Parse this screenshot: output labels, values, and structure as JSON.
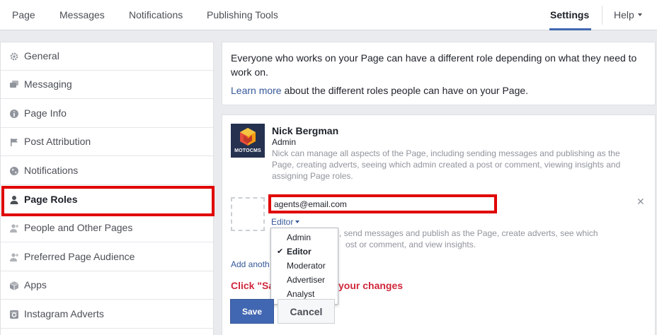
{
  "nav": {
    "items": [
      "Page",
      "Messages",
      "Notifications",
      "Publishing Tools"
    ],
    "settings": "Settings",
    "help": "Help"
  },
  "sidebar": {
    "items": [
      {
        "label": "General",
        "icon": "gear-icon"
      },
      {
        "label": "Messaging",
        "icon": "chat-icon"
      },
      {
        "label": "Page Info",
        "icon": "info-icon"
      },
      {
        "label": "Post Attribution",
        "icon": "flag-icon"
      },
      {
        "label": "Notifications",
        "icon": "globe-icon"
      },
      {
        "label": "Page Roles",
        "icon": "person-icon",
        "active": true
      },
      {
        "label": "People and Other Pages",
        "icon": "people-icon"
      },
      {
        "label": "Preferred Page Audience",
        "icon": "people-icon"
      },
      {
        "label": "Apps",
        "icon": "cube-icon"
      },
      {
        "label": "Instagram Adverts",
        "icon": "instagram-icon"
      }
    ]
  },
  "intro": {
    "text": "Everyone who works on your Page can have a different role depending on what they need to work on.",
    "learn_more": "Learn more",
    "learn_more_rest": " about the different roles people can have on your Page."
  },
  "admin": {
    "avatar_caption": "MOTOCMS",
    "name": "Nick Bergman",
    "role": "Admin",
    "description": "Nick can manage all aspects of the Page, including sending messages and publishing as the Page, creating adverts, seeing which admin created a post or comment, viewing insights and assigning Page roles."
  },
  "new_role": {
    "email_value": "agents@email.com",
    "selected_role": "Editor",
    "description_line1": ", send messages and publish as the Page, create adverts, see which",
    "description_line2": "ost or comment, and view insights.",
    "options": [
      "Admin",
      "Editor",
      "Moderator",
      "Advertiser",
      "Analyst"
    ]
  },
  "add_another": "Add anoth",
  "click_save_left": "Click \"Sa",
  "click_save_right": "your changes",
  "buttons": {
    "save": "Save",
    "cancel": "Cancel"
  },
  "colors": {
    "accent": "#4267b2",
    "highlight": "#e00000",
    "warning_text": "#d0283b"
  }
}
